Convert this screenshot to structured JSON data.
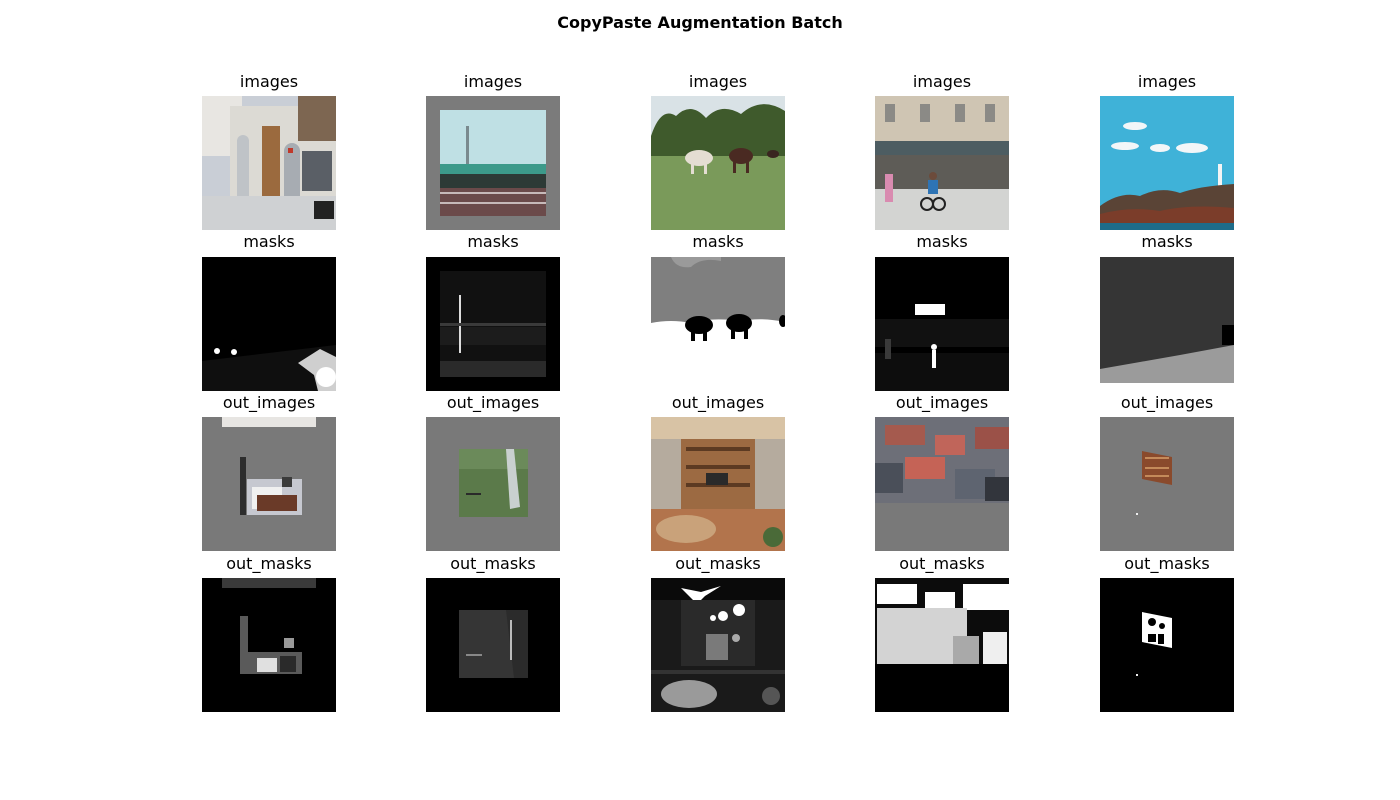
{
  "figure": {
    "title": "CopyPaste Augmentation Batch"
  },
  "rows": [
    {
      "label": "images",
      "cells": [
        {
          "name": "street-building-arches-photo"
        },
        {
          "name": "waterfront-pier-padded-photo"
        },
        {
          "name": "cows-in-pasture-photo"
        },
        {
          "name": "storefront-cyclists-photo"
        },
        {
          "name": "coastal-lighthouse-sky-photo"
        }
      ]
    },
    {
      "label": "masks",
      "cells": [
        {
          "name": "street-segmentation-mask"
        },
        {
          "name": "pier-segmentation-mask"
        },
        {
          "name": "cows-segmentation-mask"
        },
        {
          "name": "storefront-segmentation-mask"
        },
        {
          "name": "coast-segmentation-mask"
        }
      ]
    },
    {
      "label": "out_images",
      "cells": [
        {
          "name": "pasted-room-photo"
        },
        {
          "name": "pasted-waterfall-photo"
        },
        {
          "name": "living-room-bookshelf-photo"
        },
        {
          "name": "pasted-interior-fragments-photo"
        },
        {
          "name": "pasted-bookshelf-small-photo"
        }
      ]
    },
    {
      "label": "out_masks",
      "cells": [
        {
          "name": "room-output-mask"
        },
        {
          "name": "waterfall-output-mask"
        },
        {
          "name": "living-room-output-mask"
        },
        {
          "name": "interior-fragments-output-mask"
        },
        {
          "name": "bookshelf-output-mask"
        }
      ]
    }
  ]
}
